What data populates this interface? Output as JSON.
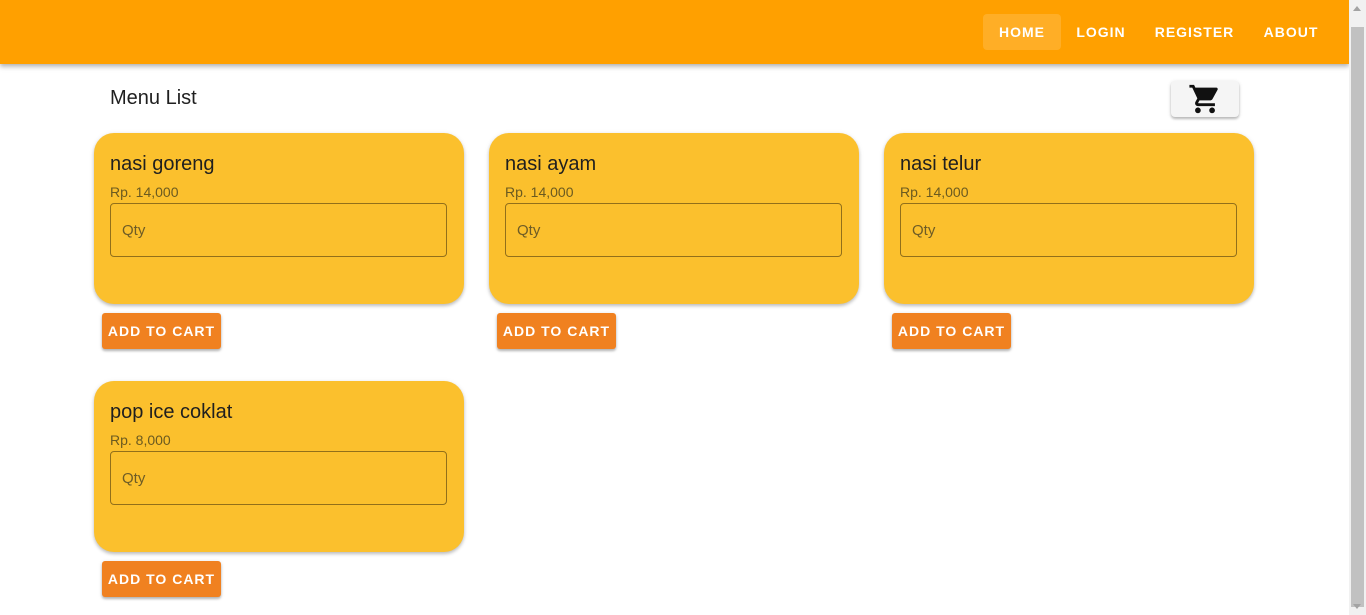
{
  "nav": {
    "items": [
      {
        "label": "HOME",
        "active": true
      },
      {
        "label": "LOGIN",
        "active": false
      },
      {
        "label": "REGISTER",
        "active": false
      },
      {
        "label": "ABOUT",
        "active": false
      }
    ]
  },
  "page": {
    "title": "Menu List",
    "cart_icon": "cart-icon"
  },
  "menu": [
    {
      "name": "nasi goreng",
      "price": "Rp. 14,000",
      "qty_placeholder": "Qty",
      "qty_value": "",
      "button": "ADD TO CART"
    },
    {
      "name": "nasi ayam",
      "price": "Rp. 14,000",
      "qty_placeholder": "Qty",
      "qty_value": "",
      "button": "ADD TO CART"
    },
    {
      "name": "nasi telur",
      "price": "Rp. 14,000",
      "qty_placeholder": "Qty",
      "qty_value": "",
      "button": "ADD TO CART"
    },
    {
      "name": "pop ice coklat",
      "price": "Rp. 8,000",
      "qty_placeholder": "Qty",
      "qty_value": "",
      "button": "ADD TO CART"
    }
  ],
  "colors": {
    "appbar": "#ffa000",
    "card": "#fbc02d",
    "button": "#f08120"
  }
}
